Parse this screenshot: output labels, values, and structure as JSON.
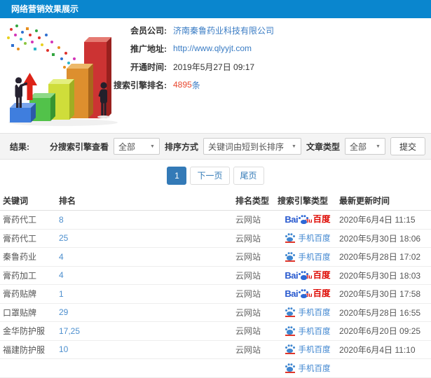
{
  "header": {
    "title": "网络营销效果展示"
  },
  "info": {
    "rows": [
      {
        "label": "会员公司:",
        "value": "济南秦鲁药业科技有限公司"
      },
      {
        "label": "推广地址:",
        "value": "http://www.qlyyjt.com"
      },
      {
        "label": "开通时间:",
        "value": "2019年5月27日 09:17"
      },
      {
        "label": "搜索引擎排名:",
        "value": "4895",
        "unit": "条"
      }
    ]
  },
  "filters": {
    "result_label": "结果:",
    "engine_view_label": "分搜索引擎查看",
    "engine_view_value": "全部",
    "sort_label": "排序方式",
    "sort_value": "关键词由短到长排序",
    "article_type_label": "文章类型",
    "article_type_value": "全部",
    "submit_label": "提交"
  },
  "pagination": {
    "current": "1",
    "next": "下一页",
    "last": "尾页"
  },
  "table": {
    "headers": [
      "关键词",
      "排名",
      "排名类型",
      "搜索引擎类型",
      "最新更新时间"
    ],
    "rows": [
      {
        "keyword": "膏药代工",
        "rank": "8",
        "rank_type": "云网站",
        "engine": "baidu",
        "updated": "2020年6月4日 11:15"
      },
      {
        "keyword": "膏药代工",
        "rank": "25",
        "rank_type": "云网站",
        "engine": "shouji",
        "updated": "2020年5月30日 18:06"
      },
      {
        "keyword": "秦鲁药业",
        "rank": "4",
        "rank_type": "云网站",
        "engine": "shouji",
        "updated": "2020年5月28日 17:02"
      },
      {
        "keyword": "膏药加工",
        "rank": "4",
        "rank_type": "云网站",
        "engine": "baidu",
        "updated": "2020年5月30日 18:03"
      },
      {
        "keyword": "膏药贴牌",
        "rank": "1",
        "rank_type": "云网站",
        "engine": "baidu",
        "updated": "2020年5月30日 17:58"
      },
      {
        "keyword": "口罩贴牌",
        "rank": "29",
        "rank_type": "云网站",
        "engine": "shouji",
        "updated": "2020年5月28日 16:55"
      },
      {
        "keyword": "金华防护服",
        "rank": "17,25",
        "rank_type": "云网站",
        "engine": "shouji",
        "updated": "2020年6月20日 09:25"
      },
      {
        "keyword": "福建防护服",
        "rank": "10",
        "rank_type": "云网站",
        "engine": "shouji",
        "updated": "2020年6月4日 11:10"
      },
      {
        "keyword": "",
        "rank": "",
        "rank_type": "",
        "engine": "shouji",
        "updated": ""
      }
    ]
  },
  "icons": {
    "caret": "▼",
    "baidu_logo": {
      "bai": "Bai",
      "du": "du",
      "brand": "百度"
    },
    "mobile_baidu_label": "手机百度"
  },
  "colors": {
    "header_bar": "#0a86ce",
    "link_blue": "#3a7cc4",
    "highlight_red": "#e8472f",
    "baidu_blue": "#2c68d6",
    "baidu_red": "#de0700",
    "pagination_active": "#337ab7"
  }
}
